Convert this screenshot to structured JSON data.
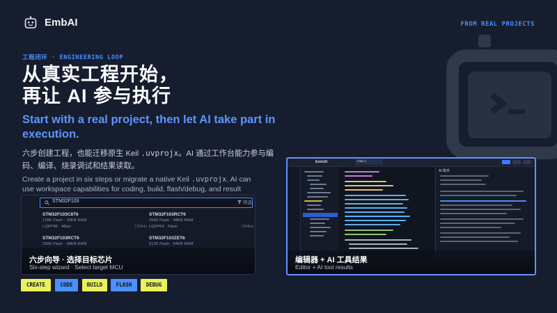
{
  "header": {
    "brand": "EmbAI",
    "top_link": "FROM REAL PROJECTS"
  },
  "hero": {
    "eyebrow": "工程闭环 · ENGINEERING LOOP",
    "title_line1": "从真实工程开始，",
    "title_line2": "再让 AI 参与执行",
    "title_en": "Start with a real project, then let AI take part in execution.",
    "desc_cn_part1": "六步创建工程，也能迁移原生 Keil ",
    "desc_cn_code": ".uvprojx",
    "desc_cn_part2": "。AI 通过工作台能力参与编码、编译、烧录调试和结果读取。",
    "desc_en_part1": "Create a project in six steps or migrate a native Keil ",
    "desc_en_code": ".uvprojx",
    "desc_en_part2": ". AI can use workspace capabilities for coding, build, flash/debug, and result reading."
  },
  "card_wizard": {
    "search_value": "STM32F103",
    "filter_label": "筛选",
    "chips": [
      {
        "name": "STM32F103C8T6",
        "line2": "128K Flash · 20KB RAM",
        "line3": "LQFP48 · 48pin",
        "right": "72MHz"
      },
      {
        "name": "STM32F103RCT6",
        "line2": "256K Flash · 48KB RAM",
        "line3": "LQFP64 · 64pin",
        "right": "72MHz"
      },
      {
        "name": "STM32F103RCT6",
        "line2": "256K Flash · 48KB RAM",
        "line3": "",
        "right": ""
      },
      {
        "name": "STM32F103ZET6",
        "line2": "512K Flash · 64KB RAM",
        "line3": "",
        "right": ""
      }
    ],
    "caption_cn": "六步向导 · 选择目标芯片",
    "caption_en": "Six-step wizard · Select target MCU"
  },
  "card_editor": {
    "app_name": "EmbAI",
    "active_tab": "main.c",
    "panel_title": "AI 助手",
    "caption_cn": "编辑器 + AI 工具结果",
    "caption_en": "Editor + AI tool results"
  },
  "tags": [
    {
      "label": "CREATE",
      "color": "#e9f25a"
    },
    {
      "label": "CODE",
      "color": "#4a90ff"
    },
    {
      "label": "BUILD",
      "color": "#e9f25a"
    },
    {
      "label": "FLASH",
      "color": "#4a90ff"
    },
    {
      "label": "DEBUG",
      "color": "#e9f25a"
    }
  ],
  "colors": {
    "accent": "#4c8dff",
    "background": "#161d2e",
    "tag_yellow": "#e9f25a",
    "tag_blue": "#4a90ff"
  }
}
